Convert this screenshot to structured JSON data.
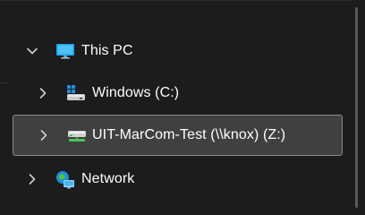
{
  "tree": {
    "items": [
      {
        "label": "This PC",
        "icon": "this-pc-icon",
        "expanded": true
      },
      {
        "label": "Windows (C:)",
        "icon": "windows-drive-icon",
        "expanded": false
      },
      {
        "label": "UIT-MarCom-Test (\\\\knox) (Z:)",
        "icon": "network-drive-icon",
        "expanded": false,
        "selected": true
      },
      {
        "label": "Network",
        "icon": "network-icon",
        "expanded": false
      }
    ]
  },
  "colors": {
    "background": "#1c1c1c",
    "selection_fill": "#404040",
    "selection_border": "#8a8a8a",
    "text": "#ffffff",
    "chevron": "#cfcfcf"
  }
}
